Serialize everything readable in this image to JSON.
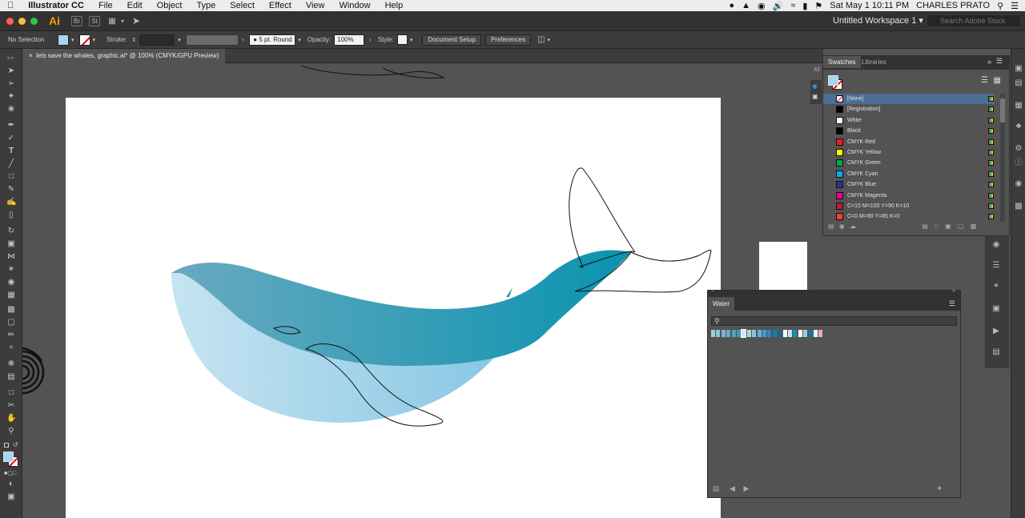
{
  "mac_menu": {
    "app": "Illustrator CC",
    "items": [
      "File",
      "Edit",
      "Object",
      "Type",
      "Select",
      "Effect",
      "View",
      "Window",
      "Help"
    ],
    "datetime": "Sat May 1  10:11 PM",
    "user": "CHARLES PRATO"
  },
  "appbar": {
    "logo": "Ai",
    "br": "Br",
    "st": "St",
    "workspace": "Untitled Workspace 1",
    "search_placeholder": "Search Adobe Stock"
  },
  "control": {
    "selection": "No Selection",
    "stroke_label": "Stroke:",
    "brush": "5 pt. Round",
    "opacity_label": "Opacity:",
    "opacity_value": "100%",
    "style_label": "Style:",
    "document_setup": "Document Setup",
    "preferences": "Preferences"
  },
  "document_tab": "lets save the whales, graphic.ai* @ 100% (CMYK/GPU Preview)",
  "swatches_panel": {
    "tabs": [
      "Swatches",
      "Libraries"
    ],
    "partial_label": "All",
    "swatches": [
      {
        "name": "[None]",
        "color": "#ffffff",
        "selected": true
      },
      {
        "name": "[Registration]",
        "color": "#000000"
      },
      {
        "name": "White",
        "color": "#ffffff"
      },
      {
        "name": "Black",
        "color": "#000000"
      },
      {
        "name": "CMYK Red",
        "color": "#ed1c24"
      },
      {
        "name": "CMYK Yellow",
        "color": "#fff200"
      },
      {
        "name": "CMYK Green",
        "color": "#00a651"
      },
      {
        "name": "CMYK Cyan",
        "color": "#00aeef"
      },
      {
        "name": "CMYK Blue",
        "color": "#2e3192"
      },
      {
        "name": "CMYK Magenta",
        "color": "#ec008c"
      },
      {
        "name": "C=15 M=100 Y=90 K=10",
        "color": "#be1e2d"
      },
      {
        "name": "C=0 M=90 Y=85 K=0",
        "color": "#ef4136"
      }
    ]
  },
  "water_panel": {
    "title": "Water",
    "colors": [
      "#9fd0dd",
      "#8ec6d6",
      "#7ab9cc",
      "#63aec4",
      "#4fa3bc",
      "#3b97b2",
      "#cfe8f1",
      "#a9d6e7",
      "#84c4dd",
      "#5eb2d4",
      "#3fa0c8",
      "#2b8cb9",
      "#1e7aa8",
      "#186892",
      "#ffffff",
      "#c6e4ef",
      "#0c97b0",
      "#ffffff",
      "#9ccfe0",
      "#1778a0",
      "#e9f5f9",
      "#f7a8a8"
    ]
  },
  "colors": {
    "whale_back_start": "#6aaac0",
    "whale_back_end": "#0a93af",
    "whale_belly_start": "#c6e4f2",
    "whale_belly_end": "#87c7e3"
  }
}
